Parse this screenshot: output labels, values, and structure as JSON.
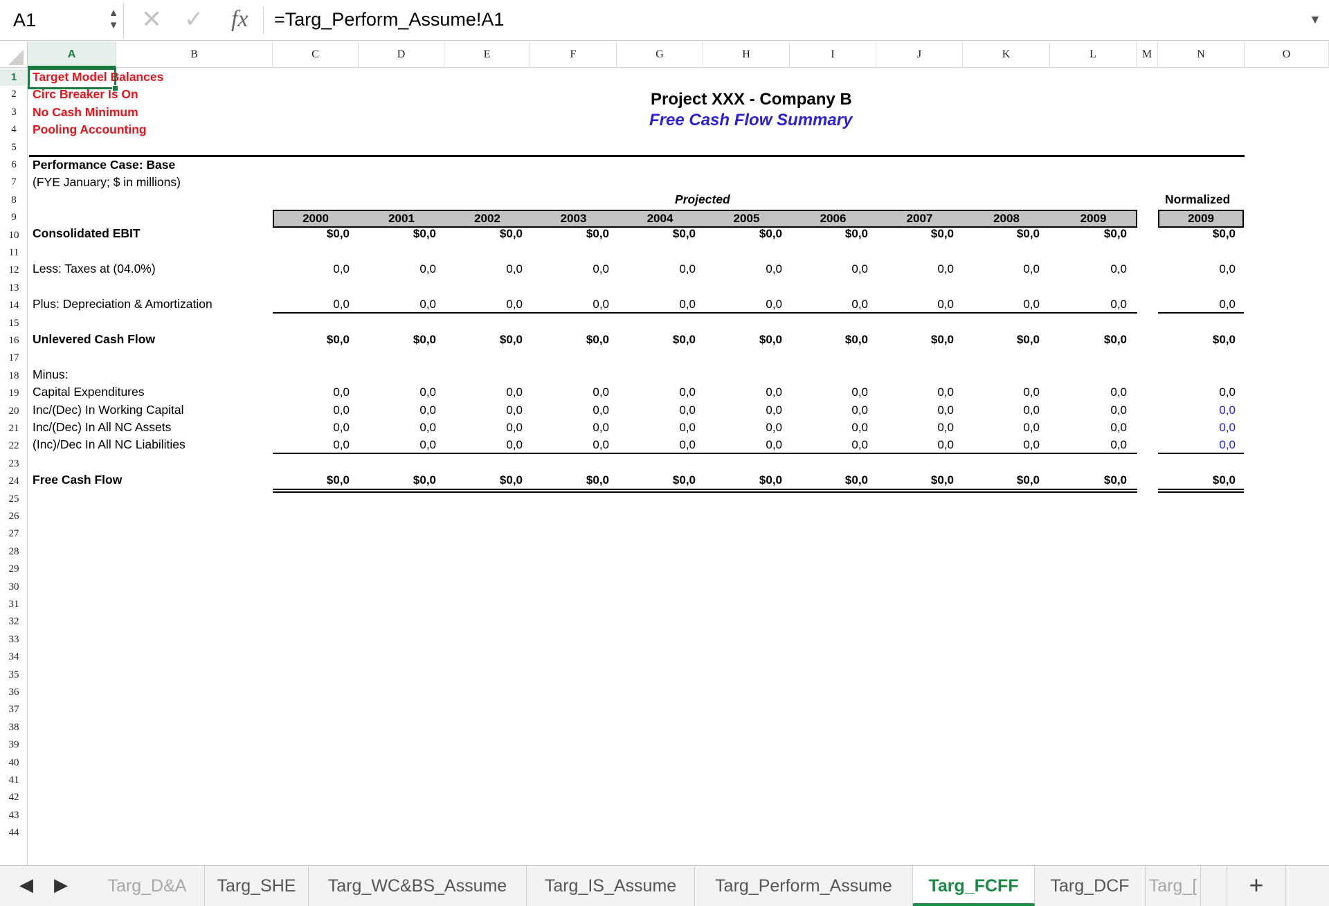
{
  "formula_bar": {
    "cell_ref": "A1",
    "formula": "=Targ_Perform_Assume!A1"
  },
  "columns": [
    "A",
    "B",
    "C",
    "D",
    "E",
    "F",
    "G",
    "H",
    "I",
    "J",
    "K",
    "L",
    "M",
    "N",
    "O"
  ],
  "rows": [
    "1",
    "2",
    "3",
    "4",
    "5",
    "6",
    "7",
    "8",
    "9",
    "10",
    "11",
    "12",
    "13",
    "14",
    "15",
    "16",
    "17",
    "18",
    "19",
    "20",
    "21",
    "22",
    "23",
    "24",
    "25",
    "26",
    "27",
    "28",
    "29",
    "30",
    "31",
    "32",
    "33",
    "34",
    "35",
    "36",
    "37",
    "38",
    "39",
    "40",
    "41",
    "42",
    "43",
    "44"
  ],
  "flags": [
    "Target Model Balances",
    "Circ Breaker Is On",
    "No Cash Minimum",
    "Pooling Accounting"
  ],
  "report": {
    "title": "Project XXX - Company B",
    "subtitle": "Free Cash Flow Summary",
    "case": "Performance Case: Base",
    "units": "(FYE January; $ in millions)",
    "projected_label": "Projected",
    "normalized_label": "Normalized",
    "years": [
      "2000",
      "2001",
      "2002",
      "2003",
      "2004",
      "2005",
      "2006",
      "2007",
      "2008",
      "2009"
    ],
    "normalized_year": "2009"
  },
  "line_items": [
    {
      "label": "Consolidated EBIT",
      "bold": true,
      "values": [
        "$0,0",
        "$0,0",
        "$0,0",
        "$0,0",
        "$0,0",
        "$0,0",
        "$0,0",
        "$0,0",
        "$0,0",
        "$0,0"
      ],
      "normalized": "$0,0",
      "norm_blue": false
    },
    {
      "label": "Less: Taxes at (04.0%)",
      "bold": false,
      "values": [
        "0,0",
        "0,0",
        "0,0",
        "0,0",
        "0,0",
        "0,0",
        "0,0",
        "0,0",
        "0,0",
        "0,0"
      ],
      "normalized": "0,0",
      "norm_blue": false
    },
    {
      "label": "Plus: Depreciation & Amortization",
      "bold": false,
      "values": [
        "0,0",
        "0,0",
        "0,0",
        "0,0",
        "0,0",
        "0,0",
        "0,0",
        "0,0",
        "0,0",
        "0,0"
      ],
      "normalized": "0,0",
      "norm_blue": false
    },
    {
      "label": "Unlevered Cash Flow",
      "bold": true,
      "values": [
        "$0,0",
        "$0,0",
        "$0,0",
        "$0,0",
        "$0,0",
        "$0,0",
        "$0,0",
        "$0,0",
        "$0,0",
        "$0,0"
      ],
      "normalized": "$0,0",
      "norm_blue": false
    },
    {
      "label": "Minus:",
      "bold": false,
      "values": [],
      "normalized": "",
      "norm_blue": false
    },
    {
      "label": "Capital Expenditures",
      "bold": false,
      "values": [
        "0,0",
        "0,0",
        "0,0",
        "0,0",
        "0,0",
        "0,0",
        "0,0",
        "0,0",
        "0,0",
        "0,0"
      ],
      "normalized": "0,0",
      "norm_blue": false
    },
    {
      "label": "Inc/(Dec) In Working Capital",
      "bold": false,
      "values": [
        "0,0",
        "0,0",
        "0,0",
        "0,0",
        "0,0",
        "0,0",
        "0,0",
        "0,0",
        "0,0",
        "0,0"
      ],
      "normalized": "0,0",
      "norm_blue": true
    },
    {
      "label": "Inc/(Dec) In All NC Assets",
      "bold": false,
      "values": [
        "0,0",
        "0,0",
        "0,0",
        "0,0",
        "0,0",
        "0,0",
        "0,0",
        "0,0",
        "0,0",
        "0,0"
      ],
      "normalized": "0,0",
      "norm_blue": true
    },
    {
      "label": "(Inc)/Dec In All NC Liabilities",
      "bold": false,
      "values": [
        "0,0",
        "0,0",
        "0,0",
        "0,0",
        "0,0",
        "0,0",
        "0,0",
        "0,0",
        "0,0",
        "0,0"
      ],
      "normalized": "0,0",
      "norm_blue": true
    },
    {
      "label": "Free Cash Flow",
      "bold": true,
      "values": [
        "$0,0",
        "$0,0",
        "$0,0",
        "$0,0",
        "$0,0",
        "$0,0",
        "$0,0",
        "$0,0",
        "$0,0",
        "$0,0"
      ],
      "normalized": "$0,0",
      "norm_blue": false
    }
  ],
  "sheet_tabs": [
    "Targ_D&A",
    "Targ_SHE",
    "Targ_WC&BS_Assume",
    "Targ_IS_Assume",
    "Targ_Perform_Assume",
    "Targ_FCFF",
    "Targ_DCF",
    "Targ_["
  ],
  "active_tab": "Targ_FCFF",
  "colors": {
    "accent_green": "#1a8a45",
    "flag_red": "#e8141b",
    "subtitle_blue": "#2b21d6",
    "input_blue": "#1a1aff"
  }
}
